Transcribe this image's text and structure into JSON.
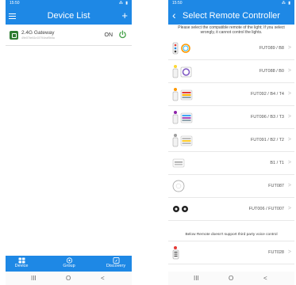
{
  "left_screen": {
    "status": {
      "time": "15:50",
      "icons": "⁂ ▮"
    },
    "title": "Device List",
    "add_label": "+",
    "device": {
      "name": "2.4G Gateway",
      "id": "49e07be61e15794eaf5b5a",
      "state": "ON"
    },
    "nav": [
      {
        "label": "Device",
        "icon": "grid-icon"
      },
      {
        "label": "Group",
        "icon": "group-icon"
      },
      {
        "label": "Discovery",
        "icon": "compass-icon"
      }
    ]
  },
  "right_screen": {
    "status": {
      "time": "15:50",
      "icons": "⁂ ▮"
    },
    "title": "Select Remote Controller",
    "prompt": "Please select the compatible remote of the light; If you select wrongly, it cannot control the lights.",
    "remotes": [
      {
        "label": "FUT089 / B8"
      },
      {
        "label": "FUT088 / B0"
      },
      {
        "label": "FUT092 / B4 / T4"
      },
      {
        "label": "FUT096 / B3 / T3"
      },
      {
        "label": "FUT091 / B2 / T2"
      },
      {
        "label": "B1 / T1"
      },
      {
        "label": "FUT087"
      },
      {
        "label": "FUT006 / FUT007"
      }
    ],
    "notice": "Below Remote doesn't support third party voice control",
    "extra_remote": {
      "label": "FUT028"
    }
  },
  "system_nav": {
    "recent": "III",
    "home": "O",
    "back": "<"
  },
  "colors": {
    "primary": "#1e88e5",
    "power_green": "#43a047",
    "device_icon": "#2e7d32"
  }
}
